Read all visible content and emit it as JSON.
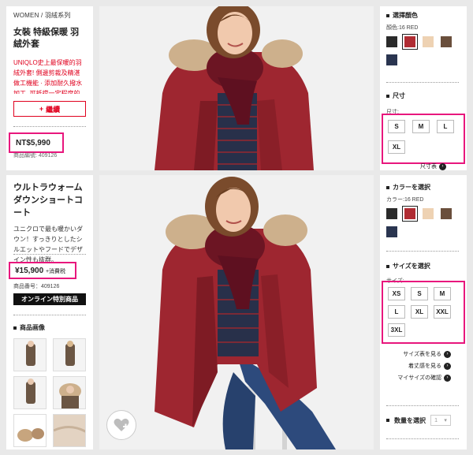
{
  "top_left": {
    "breadcrumb": "WOMEN / 羽絨系列",
    "title": "女裝 特級保暖 羽絨外套",
    "description": "UNIQLO史上最保暖的羽絨外套! 側邊剪裁及精湛做工機能 · 添加耐久撥水加工, 可抵擋一定程度的雨水",
    "more_label": "繼續",
    "price": "NT$5,990",
    "item_no": "商品編號: 409126"
  },
  "top_right": {
    "color_heading": "選擇顏色",
    "color_sub": "顏色:16 RED",
    "size_heading": "尺寸",
    "size_sub": "尺寸:",
    "sizes": [
      "S",
      "M",
      "L",
      "XL"
    ],
    "size_chart_link": "尺寸表"
  },
  "bottom_left": {
    "title": "ウルトラウォームダウンショートコート",
    "description": "ユニクロで最も暖かいダウン！すっきりとしたシルエットやフードでデザイン性も抜群。",
    "price": "¥15,900",
    "tax_note": "+消費税",
    "item_no": "商品番号：409126",
    "online_label": "オンライン特別商品",
    "thumbs_heading": "商品画像"
  },
  "bottom_right": {
    "color_heading": "カラーを選択",
    "color_sub": "カラー:16 RED",
    "size_heading": "サイズを選択",
    "size_sub": "サイズ:",
    "sizes": [
      "XS",
      "S",
      "M",
      "L",
      "XL",
      "XXL",
      "3XL"
    ],
    "links": [
      "サイズ表を見る",
      "着丈感を見る",
      "マイサイズの確認"
    ],
    "qty_heading": "数量を選択",
    "qty_value": "1"
  },
  "colors": {
    "swatches_top": [
      "#2b2b2b",
      "#b02c33",
      "#eed2b3",
      "#6a4f3c",
      "#2a3550"
    ],
    "swatches_bottom": [
      "#2b2b2b",
      "#b02c33",
      "#eed2b3",
      "#6a4f3c",
      "#2a3550"
    ],
    "highlight": "#e8177d",
    "red_accent": "#e0001e"
  }
}
